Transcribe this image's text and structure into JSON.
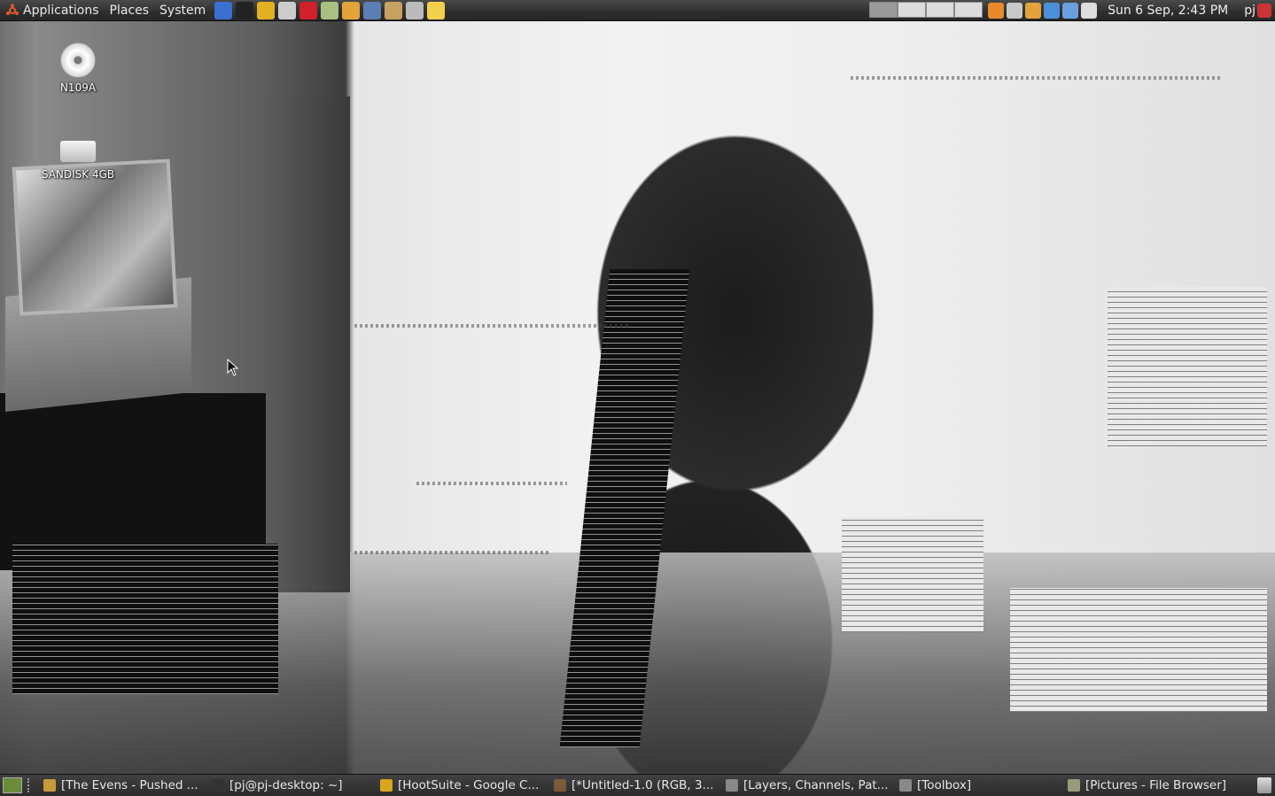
{
  "top_panel": {
    "menus": [
      "Applications",
      "Places",
      "System"
    ],
    "launchers": [
      {
        "name": "arch-icon",
        "color": "#3b6fd1"
      },
      {
        "name": "terminal-icon",
        "color": "#222222"
      },
      {
        "name": "chrome-icon",
        "color": "#e0b020"
      },
      {
        "name": "inkscape-icon",
        "color": "#cccccc"
      },
      {
        "name": "m-app-icon",
        "color": "#d0202a"
      },
      {
        "name": "messenger-icon",
        "color": "#a8c080"
      },
      {
        "name": "file-manager-icon",
        "color": "#e3a33a"
      },
      {
        "name": "network-icon",
        "color": "#5b7fb0"
      },
      {
        "name": "gimp-icon",
        "color": "#c8a060"
      },
      {
        "name": "screenshot-icon",
        "color": "#bbbbbb"
      },
      {
        "name": "notes-icon",
        "color": "#f2d04a"
      }
    ],
    "tray_icons": [
      {
        "name": "update-icon",
        "color": "#e88a2a"
      },
      {
        "name": "download-icon",
        "color": "#c9c9c9"
      },
      {
        "name": "folder-icon",
        "color": "#e3a33a"
      },
      {
        "name": "dropbox-icon",
        "color": "#4a90d9"
      },
      {
        "name": "signal-icon",
        "color": "#6aa0e0"
      },
      {
        "name": "volume-icon",
        "color": "#dddddd"
      }
    ],
    "clock": "Sun  6 Sep,  2:43 PM",
    "user": "pj"
  },
  "desktop": {
    "icons": [
      {
        "label": "N109A",
        "type": "disc"
      },
      {
        "label": "SANDISK 4GB",
        "type": "drive"
      }
    ]
  },
  "taskbar": {
    "tasks": [
      {
        "label": "[The Evens - Pushed ...",
        "icon": "folder-icon",
        "color": "#c89a3a"
      },
      {
        "label": "[pj@pj-desktop: ~]",
        "icon": "terminal-icon",
        "color": "#333333"
      },
      {
        "label": "[HootSuite - Google C...",
        "icon": "chrome-icon",
        "color": "#d9a520"
      },
      {
        "label": "[*Untitled-1.0 (RGB, 3...",
        "icon": "gimp-icon",
        "color": "#7a5a3a"
      },
      {
        "label": "[Layers, Channels, Pat...",
        "icon": "gimp-dock-icon",
        "color": "#888888"
      },
      {
        "label": "[Toolbox]",
        "icon": "gimp-toolbox-icon",
        "color": "#888888"
      },
      {
        "label": "[Pictures - File Browser]",
        "icon": "file-browser-icon",
        "color": "#9a9a7a"
      }
    ]
  }
}
